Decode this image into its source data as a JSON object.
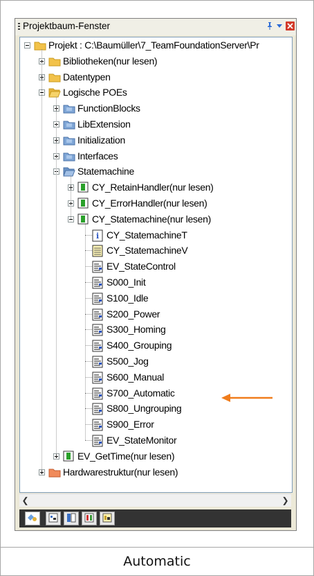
{
  "window": {
    "title": "Projektbaum-Fenster"
  },
  "tree": [
    {
      "label": "Projekt : C:\\Baumüller\\7_TeamFoundationServer\\Pr",
      "icon": "folder-icon",
      "expander": "minus"
    },
    {
      "label": "Bibliotheken(nur lesen)",
      "icon": "folder-icon",
      "expander": "plus"
    },
    {
      "label": "Datentypen",
      "icon": "folder-icon",
      "expander": "plus"
    },
    {
      "label": "Logische POEs",
      "icon": "folder-open-icon",
      "expander": "minus"
    },
    {
      "label": "FunctionBlocks",
      "icon": "blue-folder-icon",
      "expander": "plus"
    },
    {
      "label": "LibExtension",
      "icon": "blue-folder-icon",
      "expander": "plus"
    },
    {
      "label": "Initialization",
      "icon": "blue-folder-icon",
      "expander": "plus"
    },
    {
      "label": "Interfaces",
      "icon": "blue-folder-icon",
      "expander": "plus"
    },
    {
      "label": "Statemachine",
      "icon": "blue-folder-open-icon",
      "expander": "minus"
    },
    {
      "label": "CY_RetainHandler(nur lesen)",
      "icon": "program-icon",
      "expander": "plus"
    },
    {
      "label": "CY_ErrorHandler(nur lesen)",
      "icon": "program-icon",
      "expander": "plus"
    },
    {
      "label": "CY_Statemachine(nur lesen)",
      "icon": "program-icon",
      "expander": "minus"
    },
    {
      "label": "CY_StatemachineT",
      "icon": "type-info-icon",
      "expander": ""
    },
    {
      "label": "CY_StatemachineV",
      "icon": "variables-icon",
      "expander": ""
    },
    {
      "label": "EV_StateControl",
      "icon": "code-sheet-icon",
      "expander": ""
    },
    {
      "label": "S000_Init",
      "icon": "code-sheet-icon",
      "expander": ""
    },
    {
      "label": "S100_Idle",
      "icon": "code-sheet-icon",
      "expander": ""
    },
    {
      "label": "S200_Power",
      "icon": "code-sheet-icon",
      "expander": ""
    },
    {
      "label": "S300_Homing",
      "icon": "code-sheet-icon",
      "expander": ""
    },
    {
      "label": "S400_Grouping",
      "icon": "code-sheet-icon",
      "expander": ""
    },
    {
      "label": "S500_Jog",
      "icon": "code-sheet-icon",
      "expander": ""
    },
    {
      "label": "S600_Manual",
      "icon": "code-sheet-icon",
      "expander": ""
    },
    {
      "label": "S700_Automatic",
      "icon": "code-sheet-icon",
      "expander": ""
    },
    {
      "label": "S800_Ungrouping",
      "icon": "code-sheet-icon",
      "expander": ""
    },
    {
      "label": "S900_Error",
      "icon": "code-sheet-icon",
      "expander": ""
    },
    {
      "label": "EV_StateMonitor",
      "icon": "code-sheet-icon",
      "expander": ""
    },
    {
      "label": "EV_GetTime(nur lesen)",
      "icon": "program-icon",
      "expander": "plus"
    },
    {
      "label": "Hardwarestruktur(nur lesen)",
      "icon": "hardware-folder-icon",
      "expander": "plus"
    }
  ],
  "bottom_tabs": [
    "project-tree-tab-icon",
    "library-tab-icon",
    "book-tab-icon",
    "color-tab-icon",
    "variables-tab-icon"
  ],
  "caption": "Automatic",
  "colors": {
    "annotation_arrow": "#f07d1c",
    "panel_bg": "#ece9d8",
    "bottom_bar": "#333333"
  }
}
